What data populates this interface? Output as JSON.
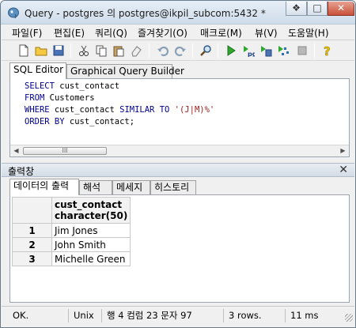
{
  "window": {
    "title": "Query - postgres 의 postgres@ikpil_subcom:5432 *",
    "controls": {
      "restore": "❖",
      "maximize": "□",
      "close": "✕"
    }
  },
  "menu": {
    "items": [
      {
        "label": "파일(F)"
      },
      {
        "label": "편집(E)"
      },
      {
        "label": "쿼리(Q)"
      },
      {
        "label": "즐겨찾기(O)"
      },
      {
        "label": "매크로(M)"
      },
      {
        "label": "뷰(V)"
      },
      {
        "label": "도움말(H)"
      }
    ]
  },
  "toolbar": {
    "icons": [
      "new-file-icon",
      "open-folder-icon",
      "save-icon",
      "cut-icon",
      "copy-icon",
      "paste-icon",
      "clear-icon",
      "undo-icon",
      "redo-icon",
      "find-icon",
      "execute-icon",
      "execute-pgscript-icon",
      "execute-to-file-icon",
      "explain-icon",
      "stop-icon",
      "help-icon"
    ]
  },
  "editor": {
    "tabs": [
      {
        "label": "SQL Editor",
        "active": true
      },
      {
        "label": "Graphical Query Builder",
        "active": false
      }
    ],
    "lines": [
      {
        "kw": "SELECT",
        "rest": " cust_contact"
      },
      {
        "kw": "FROM",
        "rest": " Customers"
      },
      {
        "kw": "WHERE",
        "rest": " cust_contact ",
        "kw2": "SIMILAR TO",
        "str": " '(J|M)%'"
      },
      {
        "kw": "ORDER BY",
        "rest": " cust_contact;"
      }
    ],
    "scroll_thumb": "III"
  },
  "output": {
    "title": "출력창",
    "close": "✕",
    "tabs": [
      {
        "label": "데이터의 출력",
        "active": true
      },
      {
        "label": "해석",
        "active": false
      },
      {
        "label": "메세지",
        "active": false
      },
      {
        "label": "히스토리",
        "active": false
      }
    ],
    "grid": {
      "column": {
        "name": "cust_contact",
        "type": "character(50)"
      },
      "rows": [
        {
          "num": "1",
          "value": "Jim Jones"
        },
        {
          "num": "2",
          "value": "John Smith"
        },
        {
          "num": "3",
          "value": "Michelle Green"
        }
      ]
    }
  },
  "status": {
    "state": "OK.",
    "line_ending": "Unix",
    "position": "행 4 컴럼 23 문자 97",
    "rows": "3 rows.",
    "time": "11 ms"
  }
}
